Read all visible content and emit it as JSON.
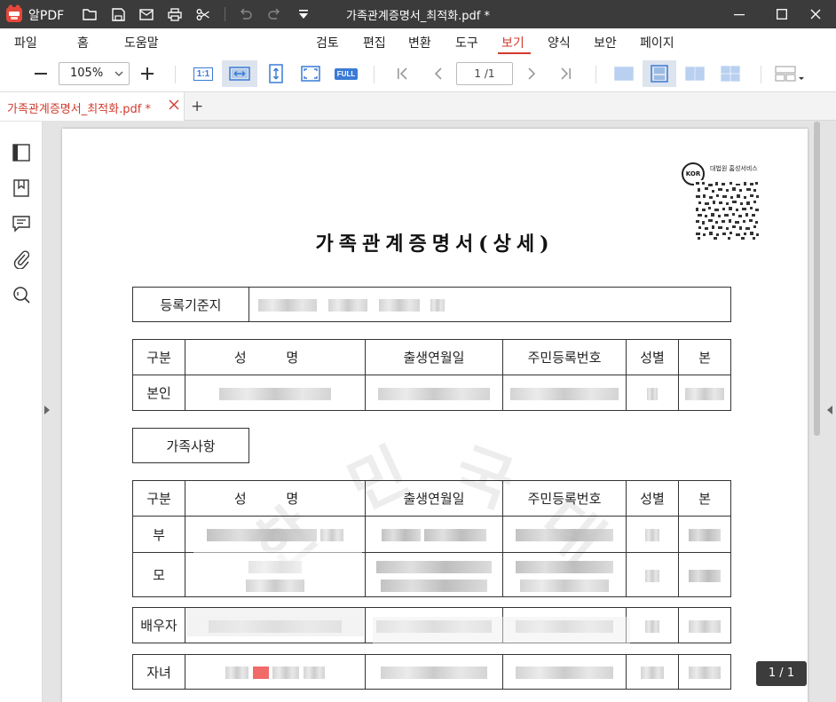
{
  "titlebar": {
    "app_name": "알PDF",
    "window_title": "가족관계증명서_최적화.pdf *",
    "icons": [
      "folder-icon",
      "save-icon",
      "mail-icon",
      "print-icon",
      "scissors-icon",
      "undo-icon",
      "redo-icon",
      "dropdown-icon"
    ]
  },
  "menu": {
    "items": [
      "파일",
      "홈",
      "도움말",
      "검토",
      "편집",
      "변환",
      "도구",
      "보기",
      "양식",
      "보안",
      "페이지"
    ],
    "active": "보기"
  },
  "toolbar": {
    "zoom": "105%",
    "actual_size_label": "1:1",
    "full_label": "FULL",
    "page_indicator": "1 /1"
  },
  "tabs": {
    "doc_tab": "가족관계증명서_최적화.pdf *",
    "add": "+"
  },
  "document": {
    "title": "가족관계증명서(상세)",
    "qr_label": "대법원 홈성서비스",
    "seal_text": "KOR",
    "registration_label": "등록기준지",
    "columns": [
      "구분",
      "성 명",
      "출생연월일",
      "주민등록번호",
      "성별",
      "본"
    ],
    "self_row_label": "본인",
    "family_section_label": "가족사항",
    "family_rows": [
      "부",
      "모"
    ],
    "spouse_label": "배우자",
    "child_label": "자녀",
    "watermark": [
      "민",
      "국",
      "대",
      "한"
    ]
  },
  "page_badge": "1 / 1",
  "colors": {
    "accent": "#d23b2e",
    "titlebar": "#3b3b3b"
  }
}
